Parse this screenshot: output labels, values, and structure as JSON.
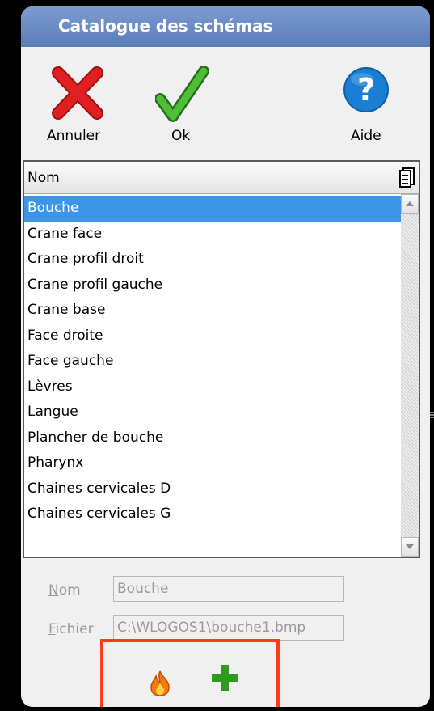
{
  "window": {
    "title": "Catalogue des schémas"
  },
  "toolbar": {
    "cancel_label": "Annuler",
    "ok_label": "Ok",
    "help_label": "Aide",
    "cancel_icon": "red-x-icon",
    "ok_icon": "green-check-icon",
    "help_icon": "blue-question-icon"
  },
  "list": {
    "column_header": "Nom",
    "column_chooser_icon": "column-chooser-icon",
    "selected_index": 0,
    "items": [
      "Bouche",
      "Crane face",
      "Crane profil droit",
      "Crane profil gauche",
      "Crane base",
      "Face droite",
      "Face gauche",
      "Lèvres",
      "Langue",
      "Plancher de bouche",
      "Pharynx",
      "Chaines cervicales D",
      "Chaines cervicales G"
    ]
  },
  "form": {
    "name_label_accel": "N",
    "name_label_rest": "om",
    "name_value": "Bouche",
    "file_label_accel": "F",
    "file_label_rest": "ichier",
    "file_value": "C:\\WLOGOS1\\bouche1.bmp"
  },
  "bottom_actions": {
    "burn_icon": "flame-icon",
    "add_icon": "plus-icon"
  },
  "colors": {
    "title_bar": "#6a8cc6",
    "selection": "#3d95e8",
    "highlight": "#ff3a1a",
    "cancel": "#e02020",
    "ok": "#3aa028",
    "help": "#1a7fd4",
    "add": "#2e9a1e"
  }
}
